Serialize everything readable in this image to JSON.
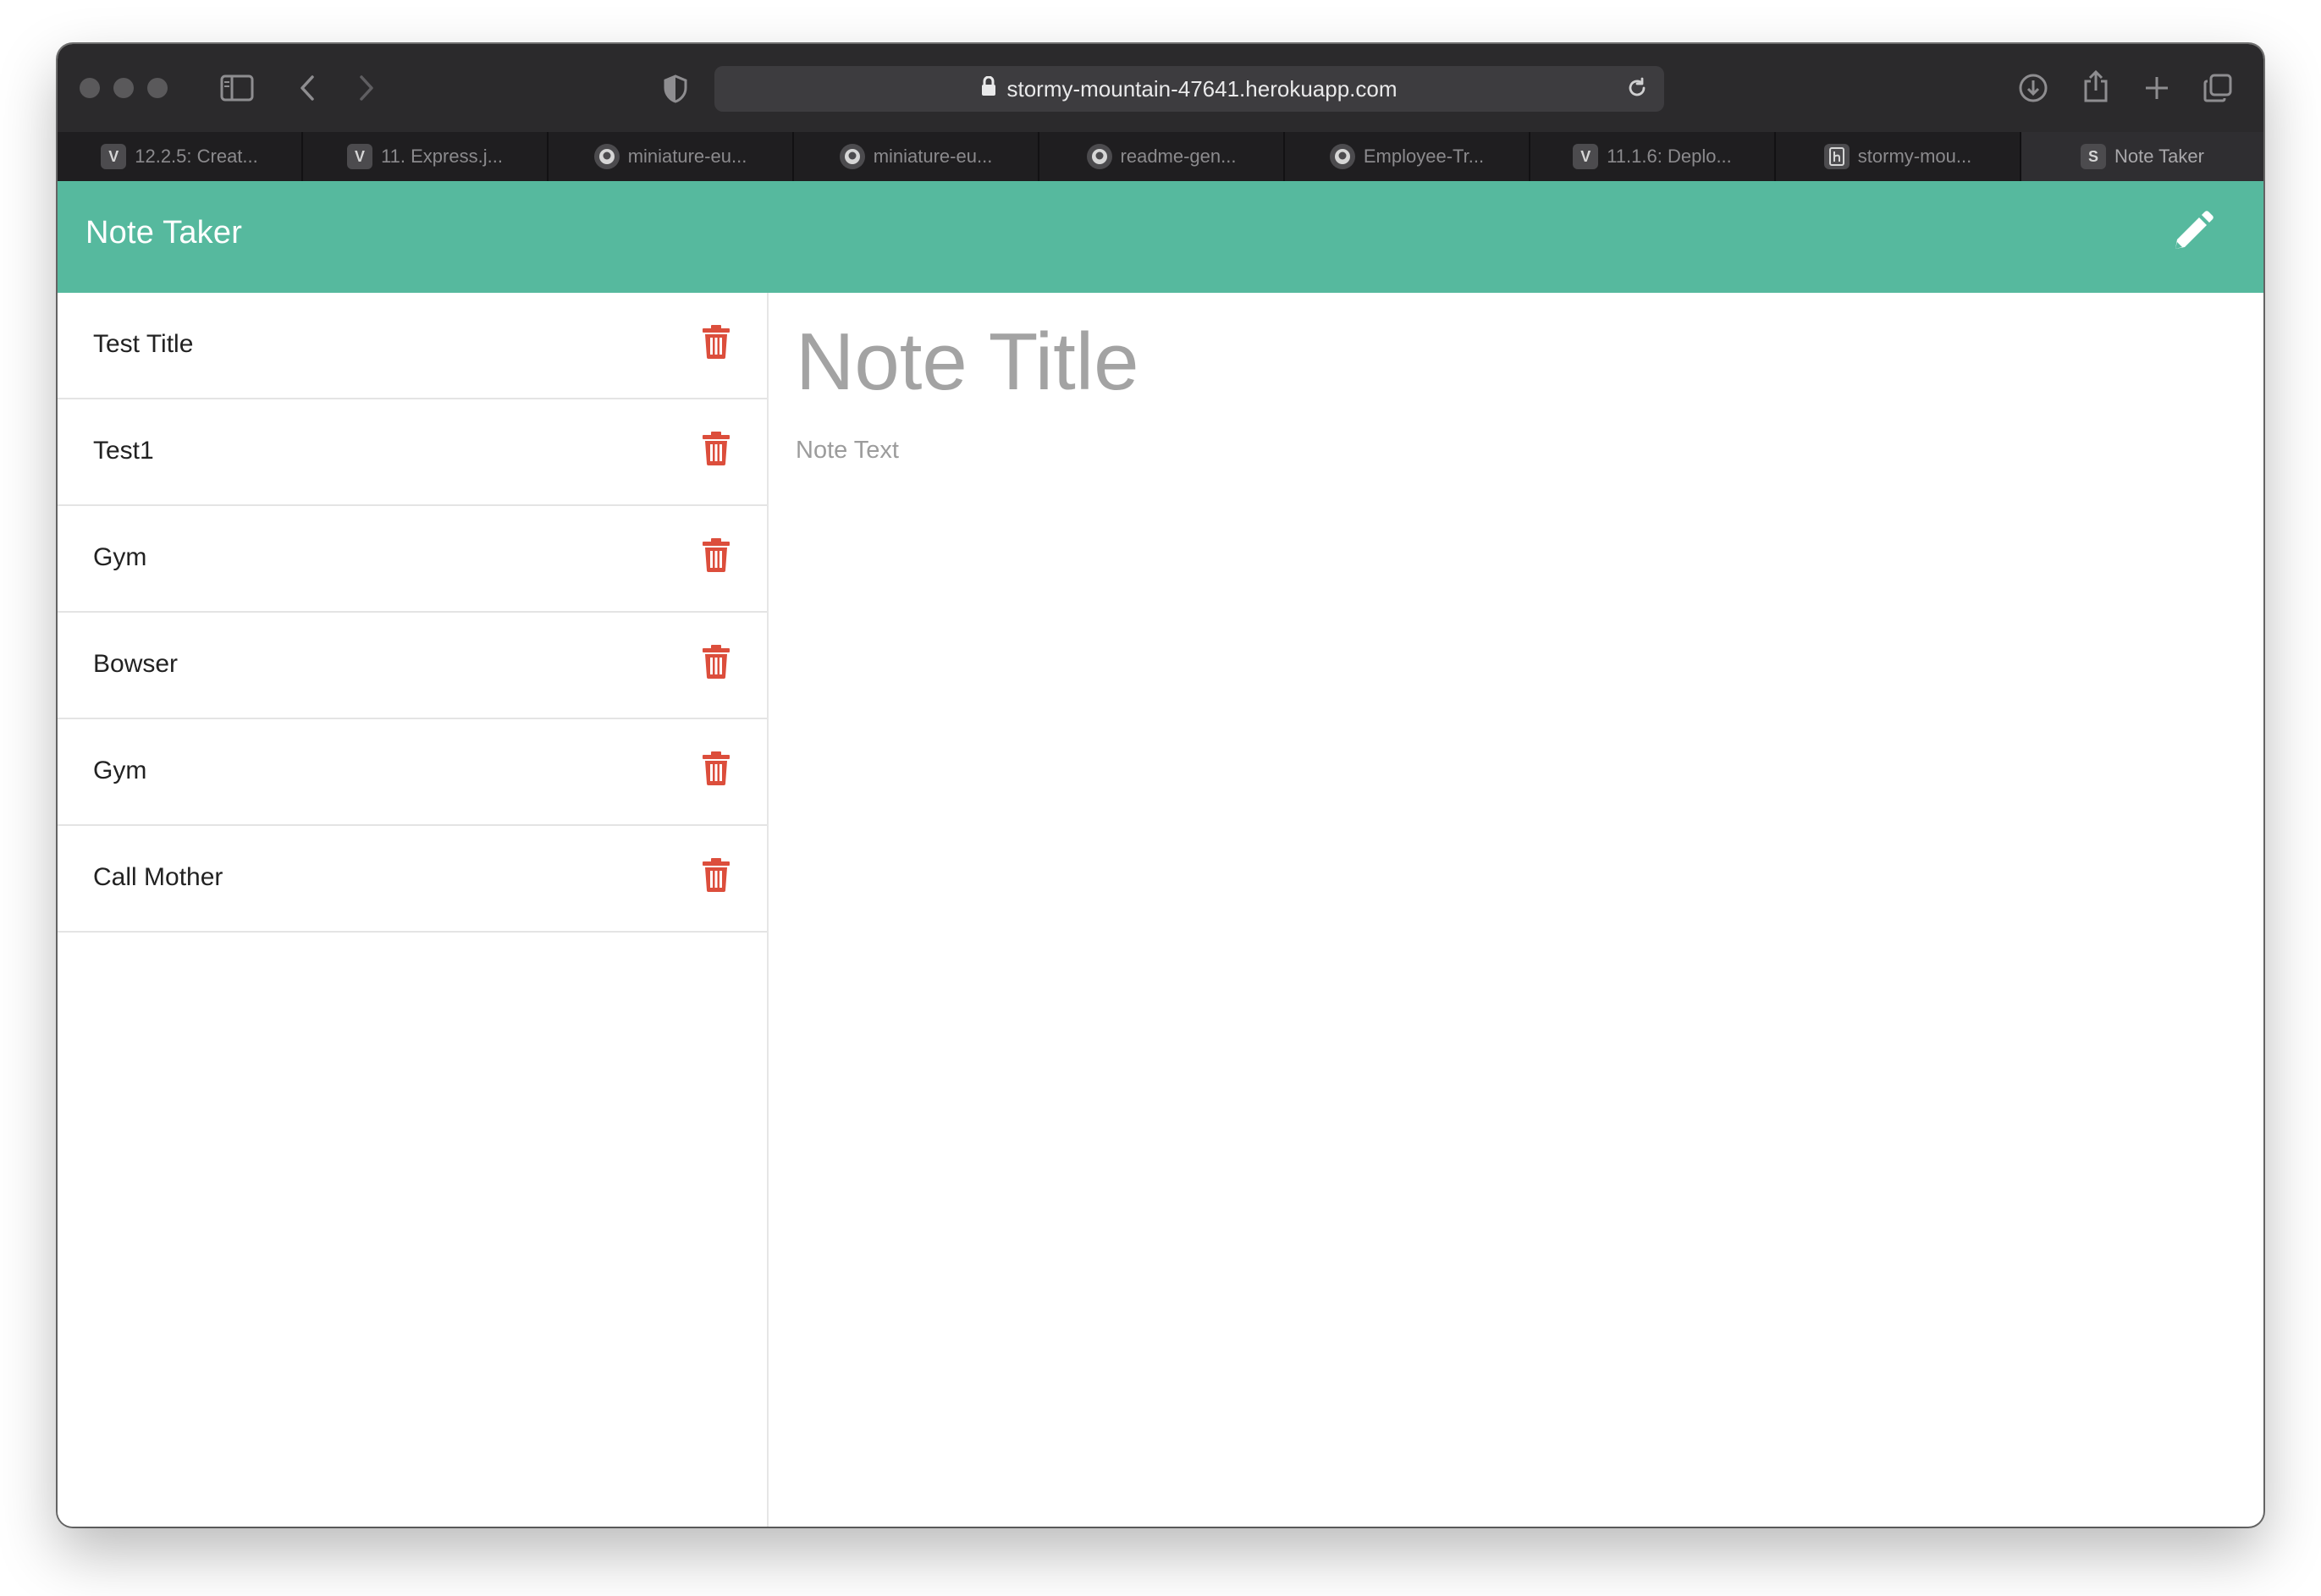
{
  "browser": {
    "url": "stormy-mountain-47641.herokuapp.com",
    "tabs": [
      {
        "favicon": "V",
        "label": "12.2.5: Creat..."
      },
      {
        "favicon": "V",
        "label": "11. Express.j..."
      },
      {
        "favicon": "github-icon",
        "label": "miniature-eu..."
      },
      {
        "favicon": "github-icon",
        "label": "miniature-eu..."
      },
      {
        "favicon": "github-icon",
        "label": "readme-gen..."
      },
      {
        "favicon": "github-icon",
        "label": "Employee-Tr..."
      },
      {
        "favicon": "V",
        "label": "11.1.6: Deplo..."
      },
      {
        "favicon": "heroku-icon",
        "label": "stormy-mou..."
      },
      {
        "favicon": "S",
        "label": "Note Taker",
        "active": true
      }
    ]
  },
  "app": {
    "title": "Note Taker",
    "accent_color": "#56b99e",
    "delete_color": "#dc4e3c"
  },
  "notes": [
    {
      "title": "Test Title"
    },
    {
      "title": "Test1"
    },
    {
      "title": "Gym"
    },
    {
      "title": "Bowser"
    },
    {
      "title": "Gym"
    },
    {
      "title": "Call Mother"
    }
  ],
  "editor": {
    "title_placeholder": "Note Title",
    "text_placeholder": "Note Text"
  }
}
